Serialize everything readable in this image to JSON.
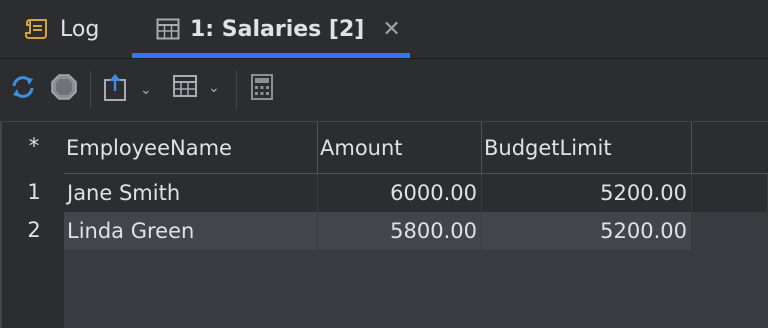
{
  "tabs": [
    {
      "label": "Log",
      "icon": "scroll-icon",
      "active": false
    },
    {
      "label": "1: Salaries [2]",
      "icon": "table-icon",
      "active": true
    }
  ],
  "accent": "#3574f0",
  "toolbar": {
    "buttons": [
      "refresh-icon",
      "stop-icon",
      "export-icon",
      "grid-view-icon",
      "calculator-icon"
    ]
  },
  "grid": {
    "corner": "*",
    "columns": [
      "EmployeeName",
      "Amount",
      "BudgetLimit"
    ],
    "rows": [
      {
        "num": "1",
        "cells": [
          "Jane Smith",
          "6000.00",
          "5200.00"
        ]
      },
      {
        "num": "2",
        "cells": [
          "Linda Green",
          "5800.00",
          "5200.00"
        ]
      }
    ]
  }
}
